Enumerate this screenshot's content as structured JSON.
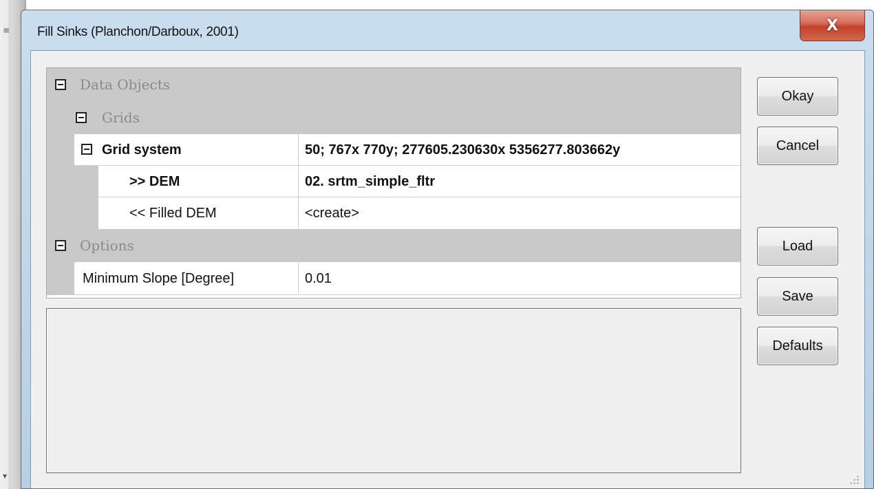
{
  "window": {
    "title": "Fill Sinks (Planchon/Darboux, 2001)",
    "close_label": "X"
  },
  "parameters": {
    "data_objects_label": "Data Objects",
    "grids_label": "Grids",
    "grid_system": {
      "label": "Grid system",
      "value": "50; 767x 770y; 277605.230630x 5356277.803662y"
    },
    "dem": {
      "label": ">> DEM",
      "value": "02. srtm_simple_fltr"
    },
    "filled_dem": {
      "label": "<< Filled DEM",
      "value": "<create>"
    },
    "options_label": "Options",
    "min_slope": {
      "label": "Minimum Slope [Degree]",
      "value": "0.01"
    }
  },
  "buttons": {
    "okay": "Okay",
    "cancel": "Cancel",
    "load": "Load",
    "save": "Save",
    "defaults": "Defaults"
  },
  "icons": {
    "expander": "collapse-icon",
    "close": "close-icon",
    "grip": "resize-grip-icon"
  }
}
